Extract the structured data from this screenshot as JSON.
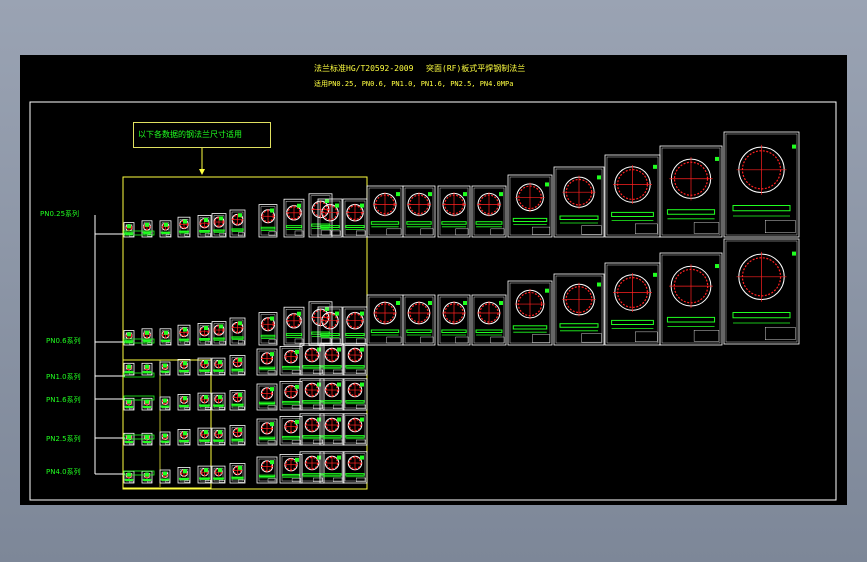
{
  "drawing": {
    "title_line1_left": "法兰标准HG/T20592-2009",
    "title_line1_right": "突面(RF)板式平焊钢制法兰",
    "title_line2": "适用PN0.25, PN0.6, PN1.0, PN1.6, PN2.5, PN4.0MPa",
    "note": "以下各数据的钢法兰尺寸适用",
    "series": [
      {
        "label": "PN0.25系列"
      },
      {
        "label": "PN0.6系列"
      },
      {
        "label": "PN1.0系列"
      },
      {
        "label": "PN1.6系列"
      },
      {
        "label": "PN2.5系列"
      },
      {
        "label": "PN4.0系列"
      }
    ]
  },
  "colors": {
    "background": "#000000",
    "frame": "#ffffff",
    "accent_yellow": "#ffff40",
    "accent_green": "#20ff20",
    "flange_red": "#ff2020"
  }
}
